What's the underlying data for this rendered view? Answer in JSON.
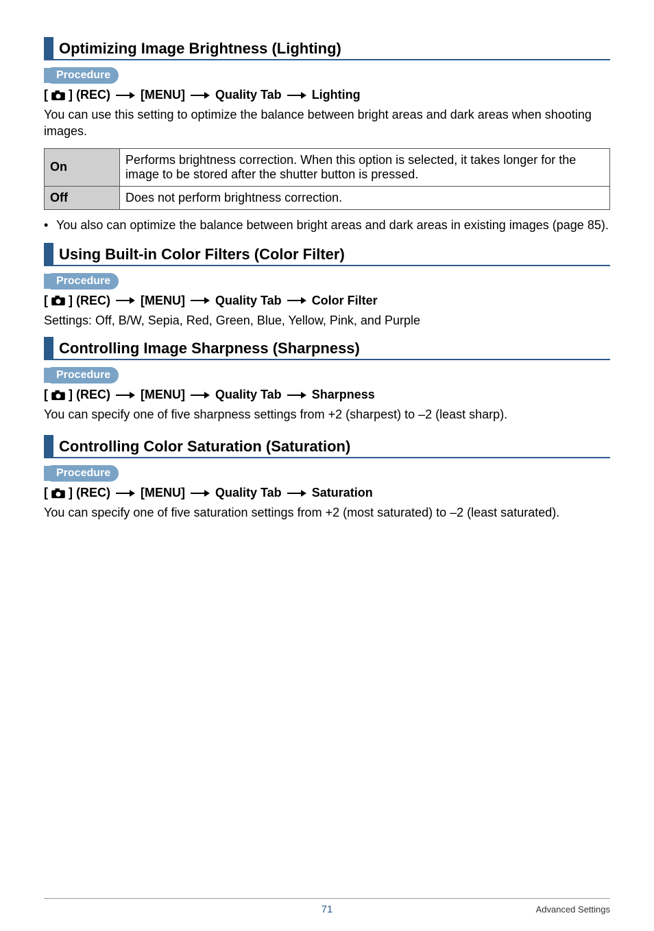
{
  "proc_label": "Procedure",
  "bc_rec_open": "[",
  "bc_rec_close": "] (REC)",
  "bc_menu": "[MENU]",
  "bc_quality": "Quality Tab",
  "sections": {
    "lighting": {
      "title": "Optimizing Image Brightness (Lighting)",
      "bc_target": "Lighting",
      "desc": "You can use this setting to optimize the balance between bright areas and dark areas when shooting images.",
      "table": {
        "on_label": "On",
        "on_desc": "Performs brightness correction. When this option is selected, it takes longer for the image to be stored after the shutter button is pressed.",
        "off_label": "Off",
        "off_desc": "Does not perform brightness correction."
      },
      "note": "You also can optimize the balance between bright areas and dark areas in existing images (page 85)."
    },
    "color_filter": {
      "title": "Using Built-in Color Filters (Color Filter)",
      "bc_target": "Color Filter",
      "desc": "Settings: Off, B/W, Sepia, Red, Green, Blue, Yellow, Pink, and Purple"
    },
    "sharpness": {
      "title": "Controlling Image Sharpness (Sharpness)",
      "bc_target": "Sharpness",
      "desc": "You can specify one of five sharpness settings from +2 (sharpest) to –2 (least sharp)."
    },
    "saturation": {
      "title": "Controlling Color Saturation (Saturation)",
      "bc_target": "Saturation",
      "desc": "You can specify one of five saturation settings from +2 (most saturated) to –2 (least saturated)."
    }
  },
  "footer": {
    "page": "71",
    "label": "Advanced Settings"
  }
}
